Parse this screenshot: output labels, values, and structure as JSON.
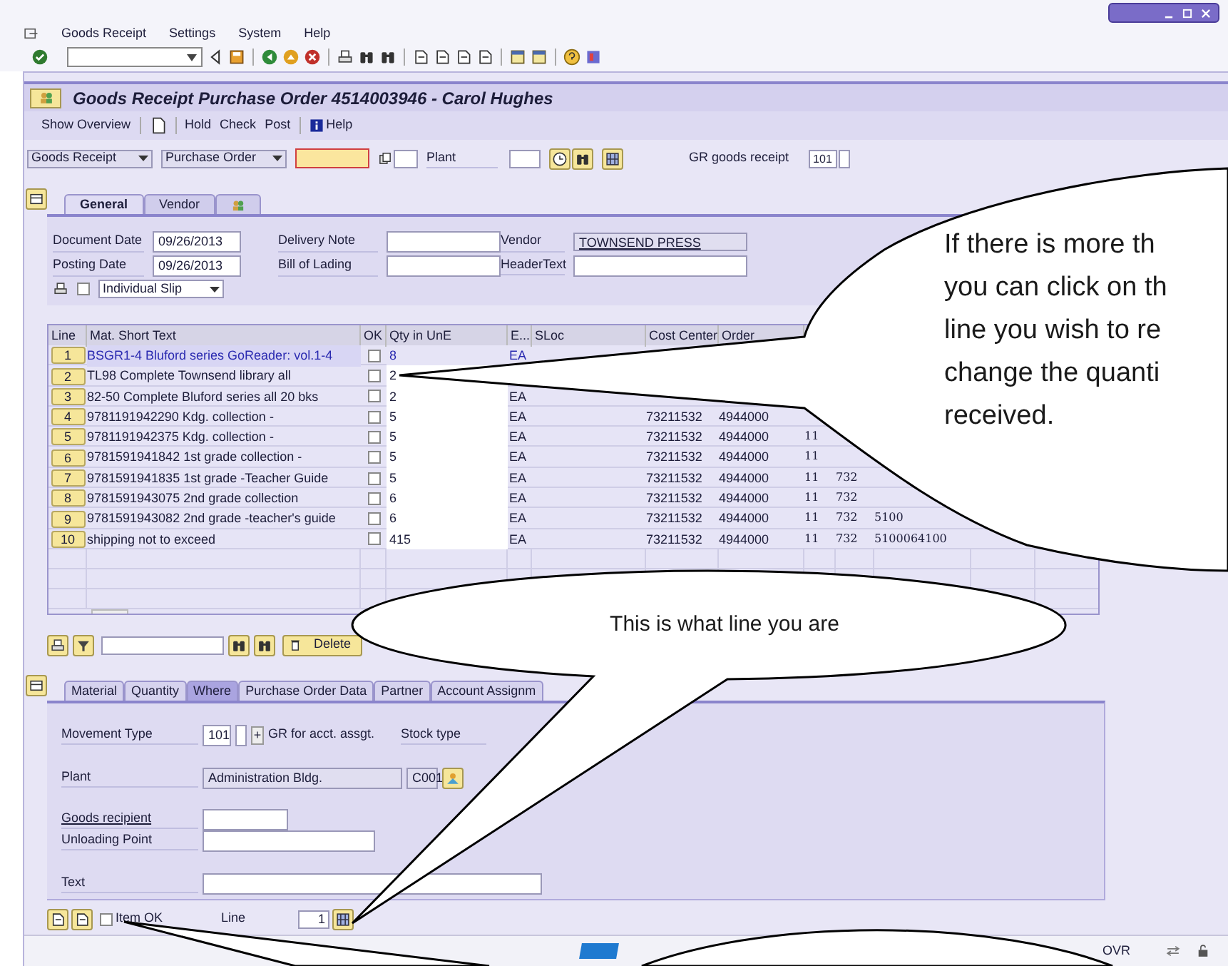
{
  "menu_bar": [
    {
      "label": "Goods Receipt"
    },
    {
      "label": "Settings"
    },
    {
      "label": "System"
    },
    {
      "label": "Help"
    }
  ],
  "title": "Goods Receipt Purchase Order 4514003946 - Carol Hughes",
  "app_toolbar": [
    "Show Overview",
    "Hold",
    "Check",
    "Post",
    "Help"
  ],
  "selection": {
    "transaction": "Goods Receipt",
    "reference": "Purchase Order",
    "plant_label": "Plant",
    "movement_label": "GR goods receipt",
    "movement_type": "101"
  },
  "header_tabs": [
    {
      "kind": "text",
      "label": "General",
      "selected": true
    },
    {
      "kind": "text",
      "label": "Vendor",
      "selected": false
    },
    {
      "kind": "icon",
      "selected": false
    }
  ],
  "general": {
    "document_date_label": "Document Date",
    "document_date": "09/26/2013",
    "posting_date_label": "Posting Date",
    "posting_date": "09/26/2013",
    "delivery_note_label": "Delivery Note",
    "bill_of_lading_label": "Bill of Lading",
    "vendor_label": "Vendor",
    "vendor": "TOWNSEND PRESS",
    "header_text_label": "HeaderText",
    "slip_checked": false,
    "slip_type": "Individual Slip"
  },
  "table": {
    "columns": [
      "Line",
      "Mat. Short Text",
      "OK",
      "Qty in UnE",
      "E...",
      "SLoc",
      "Cost Center",
      "Order"
    ],
    "rows": [
      {
        "line": "1",
        "selected": true,
        "text": "BSGR1-4 Bluford series GoReader: vol.1-4",
        "ok": false,
        "qty": "8",
        "unit": "EA"
      },
      {
        "line": "2",
        "selected": false,
        "text": "TL98 Complete Townsend library all",
        "ok": false,
        "qty": "2"
      },
      {
        "line": "3",
        "selected": false,
        "text": "82-50 Complete Bluford series all 20 bks",
        "ok": false,
        "qty": "2",
        "unit": "EA"
      },
      {
        "line": "4",
        "selected": false,
        "text": "9781191942290 Kdg. collection -",
        "ok": false,
        "qty": "5",
        "unit": "EA",
        "cost_center": "73211532",
        "order": "4944000"
      },
      {
        "line": "5",
        "selected": false,
        "text": "9781191942375 Kdg. collection -",
        "ok": false,
        "qty": "5",
        "unit": "EA",
        "cost_center": "73211532",
        "order": "4944000",
        "column_9": "11"
      },
      {
        "line": "6",
        "selected": false,
        "text": "9781591941842 1st grade collection -",
        "ok": false,
        "qty": "5",
        "unit": "EA",
        "cost_center": "73211532",
        "order": "4944000",
        "column_9": "11"
      },
      {
        "line": "7",
        "selected": false,
        "text": "9781591941835 1st grade -Teacher Guide",
        "ok": false,
        "qty": "5",
        "unit": "EA",
        "cost_center": "73211532",
        "order": "4944000",
        "column_9": "11",
        "column_10": "732"
      },
      {
        "line": "8",
        "selected": false,
        "text": "9781591943075 2nd grade collection",
        "ok": false,
        "qty": "6",
        "unit": "EA",
        "cost_center": "73211532",
        "order": "4944000",
        "column_9": "11",
        "column_10": "732"
      },
      {
        "line": "9",
        "selected": false,
        "text": "9781591943082 2nd grade -teacher's guide",
        "ok": false,
        "qty": "6",
        "unit": "EA",
        "cost_center": "73211532",
        "order": "4944000",
        "column_9": "11",
        "column_10": "732",
        "column_11": "5100"
      },
      {
        "line": "10",
        "selected": false,
        "text": "shipping not to exceed",
        "ok": false,
        "qty": "415",
        "unit": "EA",
        "cost_center": "73211532",
        "order": "4944000",
        "column_9": "11",
        "column_10": "732",
        "column_11": "5100064100"
      }
    ]
  },
  "item_toolbar": {
    "delete": "Delete"
  },
  "detail_tabs": [
    {
      "label": "Material",
      "selected": false
    },
    {
      "label": "Quantity",
      "selected": false
    },
    {
      "label": "Where",
      "selected": true
    },
    {
      "label": "Purchase Order Data",
      "selected": false
    },
    {
      "label": "Partner",
      "selected": false
    },
    {
      "label": "Account Assignm",
      "selected": false
    }
  ],
  "where": {
    "movement_type_label": "Movement Type",
    "movement_type": "101",
    "plus": "+",
    "gr_label": "GR for acct. assgt.",
    "stock_type_label": "Stock type",
    "plant_label": "Plant",
    "plant_name": "Administration Bldg.",
    "plant_code": "C001",
    "goods_recipient_label": "Goods recipient",
    "unloading_point_label": "Unloading Point",
    "text_label": "Text"
  },
  "footer": {
    "item_ok_label": "Item OK",
    "item_ok_checked": false,
    "line_label": "Line",
    "line": "1"
  },
  "status_bar": {
    "mode": "OVR"
  },
  "callouts": [
    {
      "lines": [
        "If there is more th",
        "you can click on th",
        "line you wish to re",
        "change the quanti",
        "received."
      ]
    },
    {
      "lines": [
        "This is what line you are"
      ]
    }
  ]
}
